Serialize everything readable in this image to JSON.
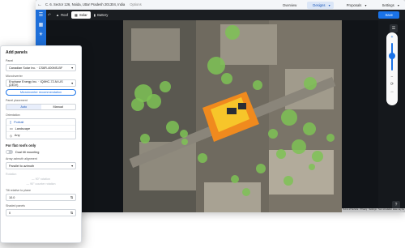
{
  "window": {
    "address": "C. 6. Sector 126, Noida, Uttar Pradesh 201304, India",
    "address_option": "Options",
    "nav": [
      {
        "label": "Overview",
        "active": false
      },
      {
        "label": "Designs",
        "active": true
      },
      {
        "label": "Proposals",
        "active": false
      },
      {
        "label": "Settings",
        "active": false
      }
    ]
  },
  "toolbar": {
    "items": [
      {
        "label": "Roof",
        "active": false
      },
      {
        "label": "Solar",
        "active": true
      },
      {
        "label": "Battery",
        "active": false
      }
    ],
    "save_label": "Save"
  },
  "map": {
    "attribution": "Terms of Service · Privacy · Settings · Sun simulation data may be estimated"
  },
  "panel": {
    "title": "Add panels",
    "panel_label": "Panel",
    "panel_value": "Canadian Solar Inc. · CS6R-400MS-BF",
    "microinverter_label": "Microinverter",
    "microinverter_value": "Enphase Energy Inc. · IQ8HC-72-M-US (240V)",
    "microinverter_button": "Microinverter recommendation",
    "placement_label": "Panel placement",
    "placement_options": [
      {
        "label": "Auto",
        "active": true
      },
      {
        "label": "Manual",
        "active": false
      }
    ],
    "orientation_label": "Orientation",
    "orientation_options": [
      {
        "label": "Portrait",
        "active": true
      },
      {
        "label": "Landscape",
        "active": false
      },
      {
        "label": "Any",
        "active": false
      }
    ],
    "flat_roofs_label": "For flat roofs only",
    "dual_tilt_label": "Dual tilt mounting",
    "array_alignment_label": "Array azimuth alignment",
    "array_alignment_value": "Parallel to azimuth",
    "rotation_label": "Rotation",
    "rotation_hint_1": "— 90° rotation",
    "rotation_hint_2": "— 90° counter rotation",
    "tilt_label": "Tilt relative to plane",
    "tilt_value": "10.0",
    "shaded_label": "Shaded panels",
    "shaded_value": "0"
  }
}
